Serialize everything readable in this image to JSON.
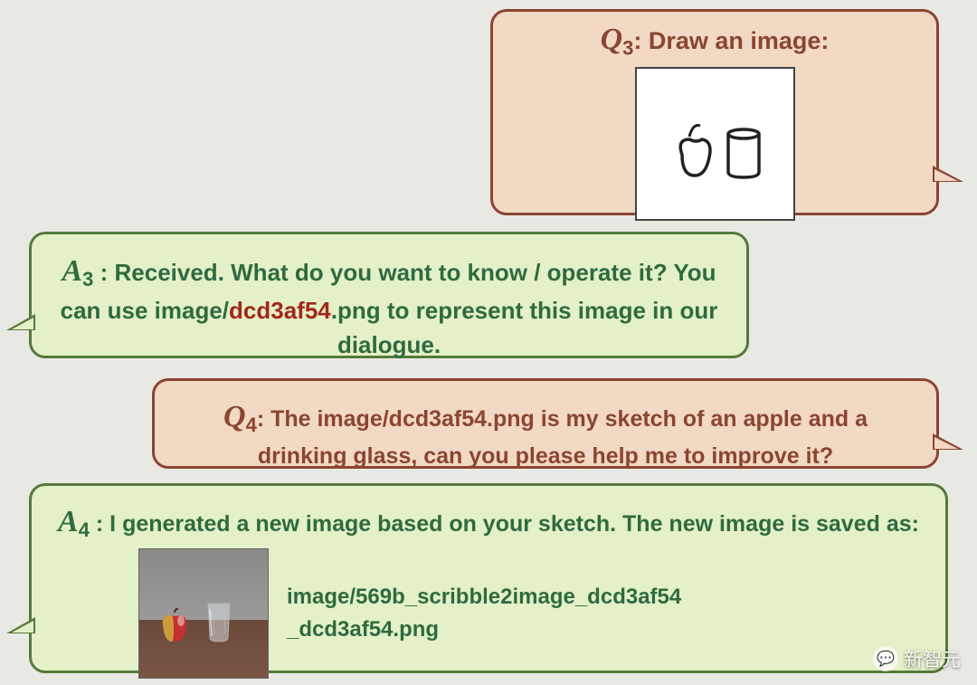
{
  "q3": {
    "label": "Q",
    "subscript": "3",
    "prompt": ": Draw an image:"
  },
  "a3": {
    "label": "A",
    "subscript": "3",
    "part1": " : Received.  What do you want to know / operate it? You can use image/",
    "highlight": "dcd3af54",
    "part2": ".png to represent this image in our dialogue."
  },
  "q4": {
    "label": "Q",
    "subscript": "4",
    "text": ": The image/dcd3af54.png is my sketch of an apple and a drinking glass, can you please help me to improve it?"
  },
  "a4": {
    "label": "A",
    "subscript": "4",
    "text_top": " : I generated a new image based on your sketch. The new image is saved as:",
    "path_line1": "image/569b_scribble2image_dcd3af54",
    "path_line2": "_dcd3af54.png"
  },
  "watermark": {
    "icon": "💬",
    "text": "新智元"
  }
}
